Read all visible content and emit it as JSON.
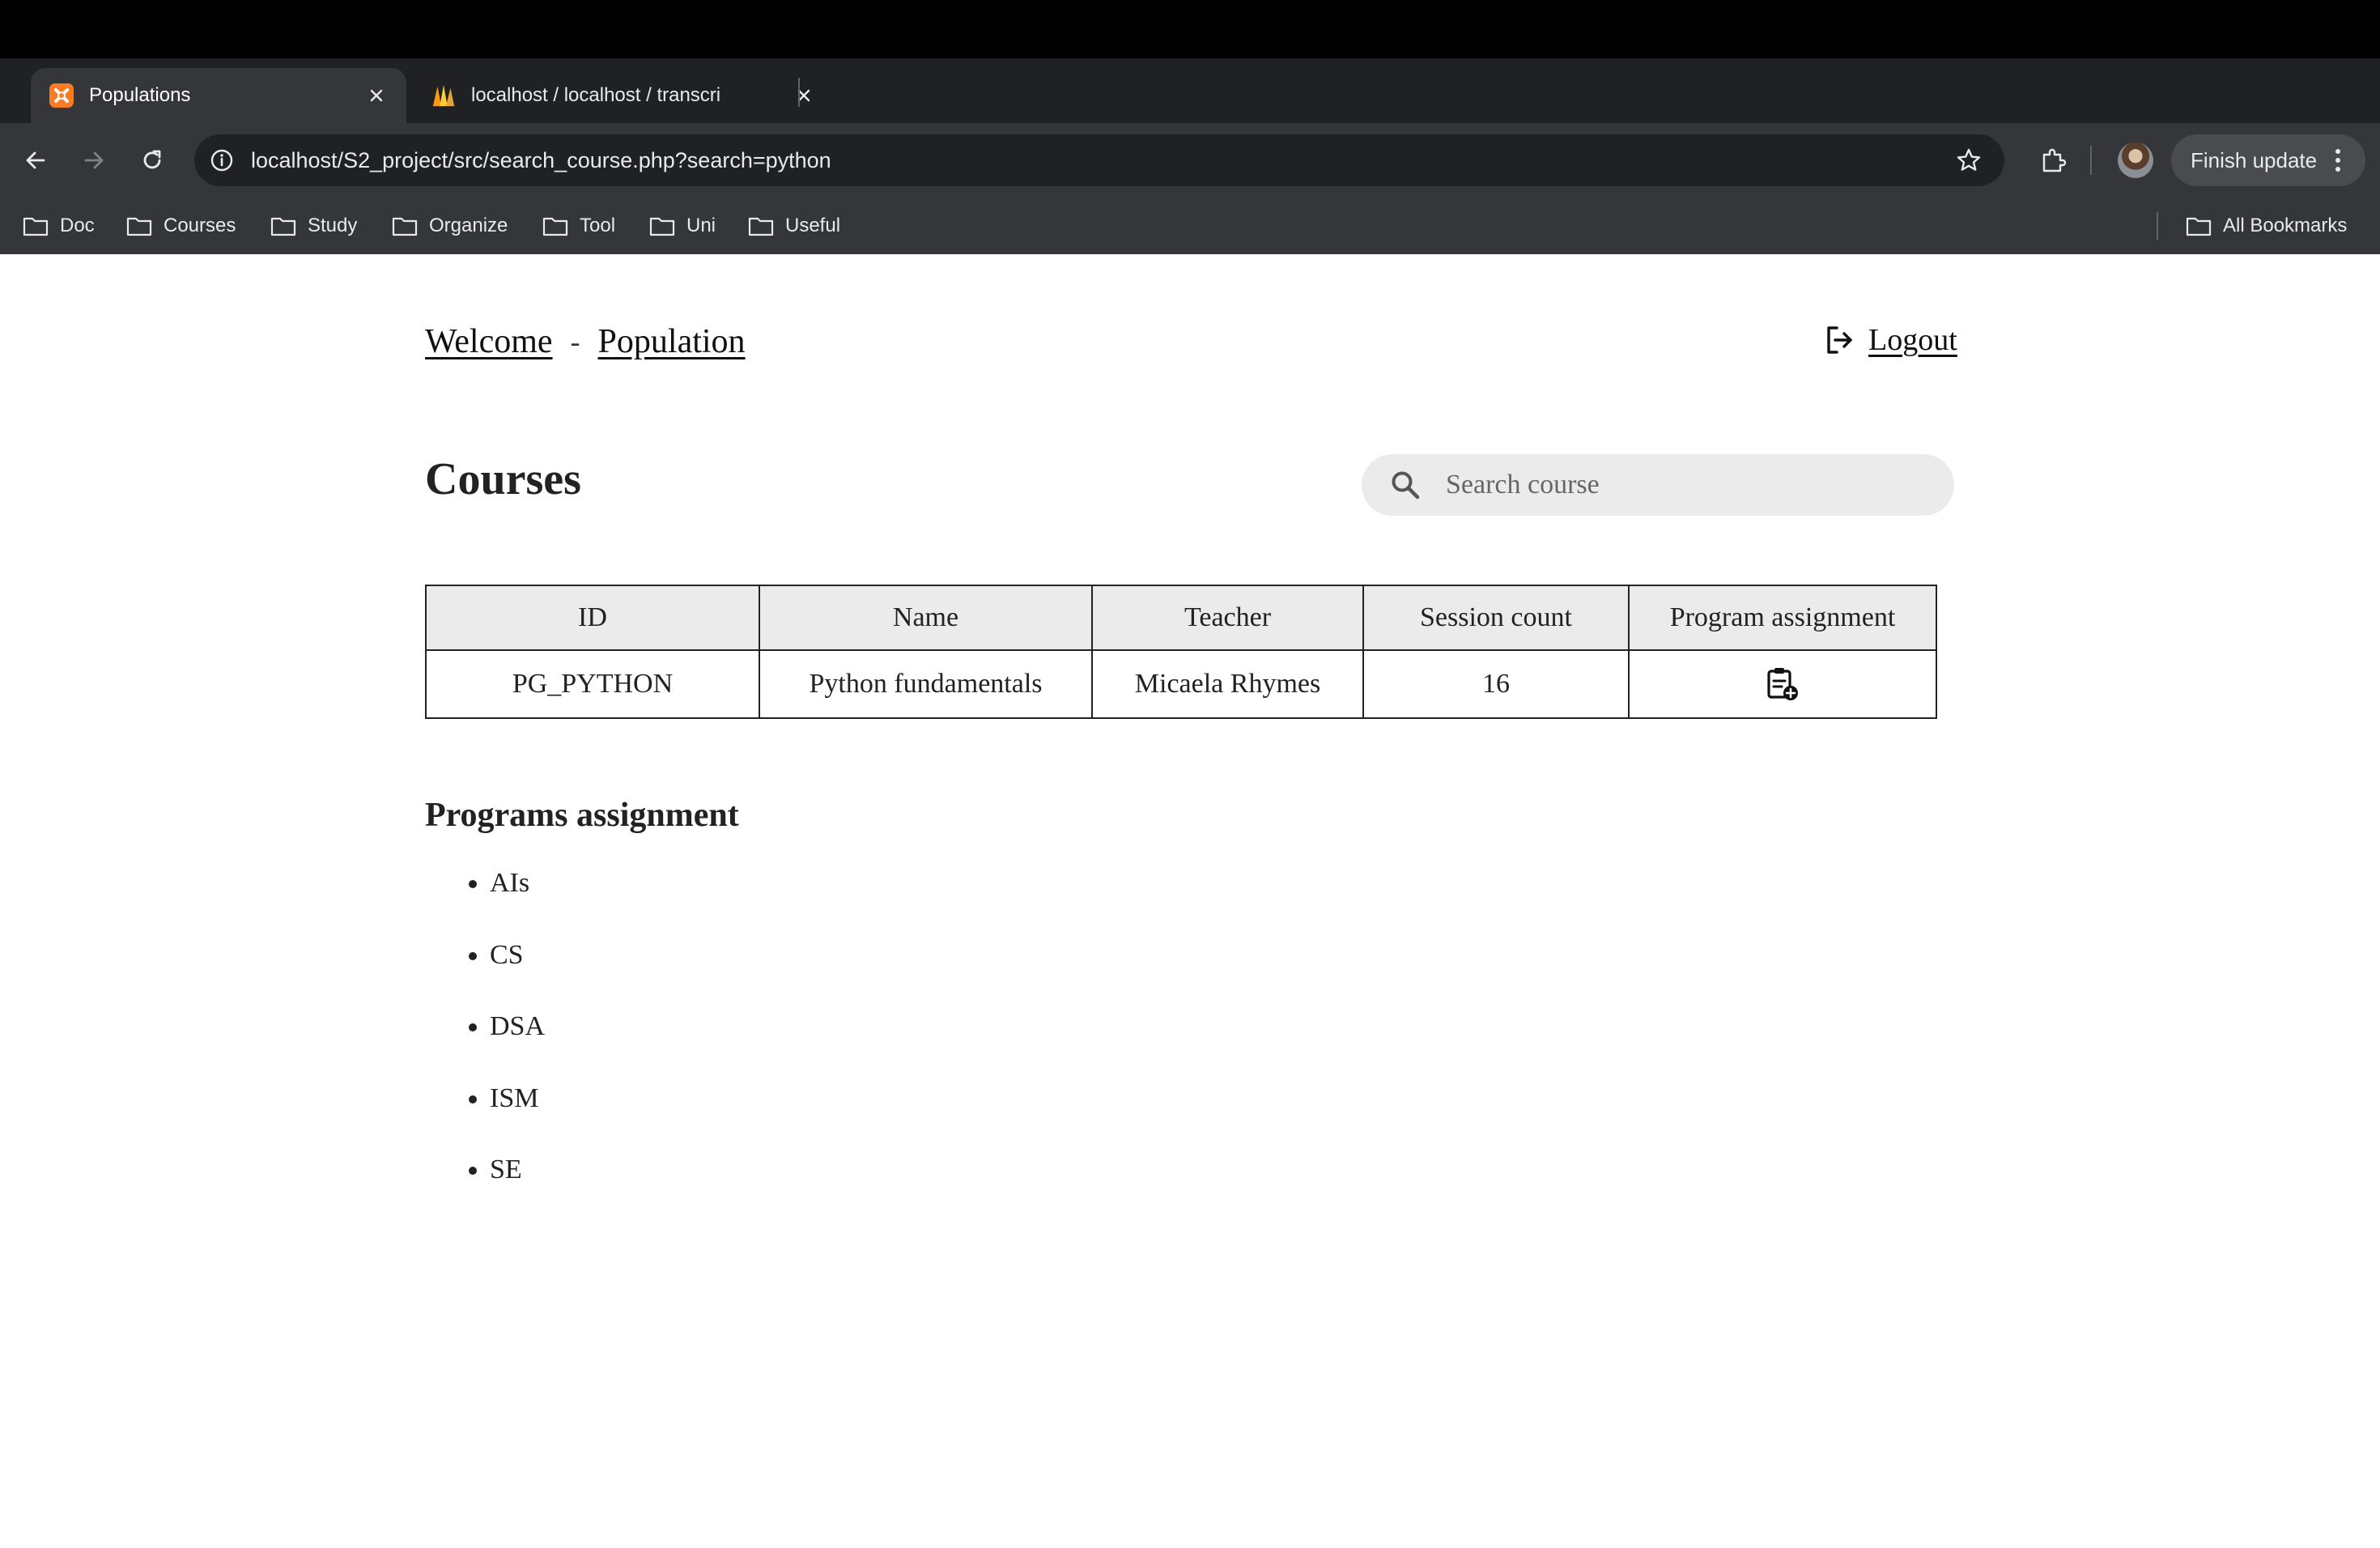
{
  "browser": {
    "tabs": [
      {
        "title": "Populations",
        "active": true,
        "icon": "xampp-icon"
      },
      {
        "title": "localhost / localhost / transcri",
        "active": false,
        "icon": "phpmyadmin-icon"
      }
    ],
    "address": "localhost/S2_project/src/search_course.php?search=python",
    "finish_update_label": "Finish update",
    "bookmarks": [
      "Doc",
      "Courses",
      "Study",
      "Organize",
      "Tool",
      "Uni",
      "Useful"
    ],
    "all_bookmarks_label": "All Bookmarks"
  },
  "nav": {
    "welcome": "Welcome",
    "separator": "-",
    "population": "Population",
    "logout": "Logout"
  },
  "courses": {
    "title": "Courses",
    "search_placeholder": "Search course",
    "columns": [
      "ID",
      "Name",
      "Teacher",
      "Session count",
      "Program assignment"
    ],
    "rows": [
      {
        "id": "PG_PYTHON",
        "name": "Python fundamentals",
        "teacher": "Micaela Rhymes",
        "session_count": "16",
        "assignment_icon": "clipboard-add-icon"
      }
    ]
  },
  "programs": {
    "title": "Programs assignment",
    "items": [
      "AIs",
      "CS",
      "DSA",
      "ISM",
      "SE"
    ]
  }
}
